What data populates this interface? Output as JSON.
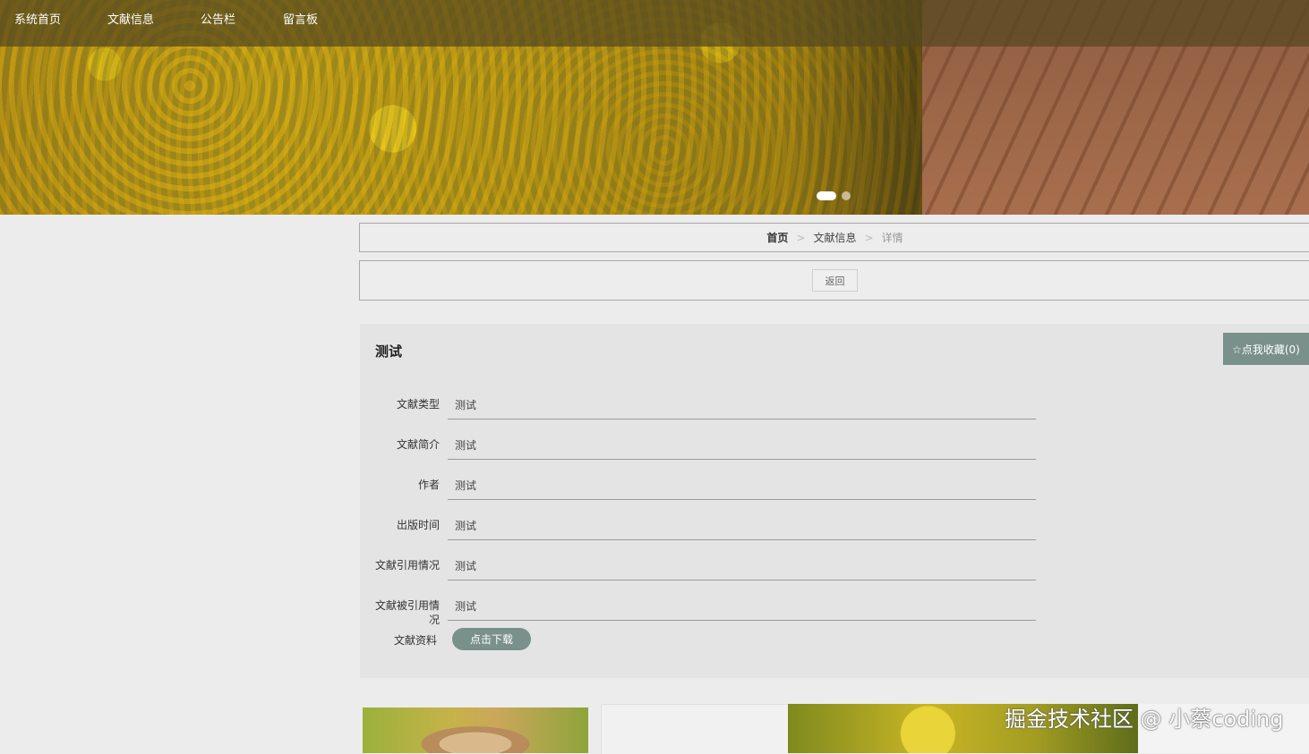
{
  "nav": {
    "items": [
      "系统首页",
      "文献信息",
      "公告栏",
      "留言板"
    ]
  },
  "banner": {
    "slide_count": 2,
    "active_slide": 1
  },
  "breadcrumb": {
    "home": "首页",
    "section": "文献信息",
    "current": "详情",
    "separator": ">"
  },
  "back_button": "返回",
  "detail": {
    "title": "测试",
    "favorite_button": "☆点我收藏(0)",
    "fields": [
      {
        "label": "文献类型",
        "value": "测试"
      },
      {
        "label": "文献简介",
        "value": "测试"
      },
      {
        "label": "作者",
        "value": "测试"
      },
      {
        "label": "出版时间",
        "value": "测试"
      },
      {
        "label": "文献引用情况",
        "value": "测试"
      },
      {
        "label": "文献被引用情况",
        "value": "测试"
      }
    ],
    "download_label": "文献资料",
    "download_button": "点击下载"
  },
  "watermark": "掘金技术社区 @ 小蔡coding",
  "colors": {
    "accent": "#7a908a",
    "nav_bg": "#55481e",
    "page_bg": "#ececec"
  }
}
